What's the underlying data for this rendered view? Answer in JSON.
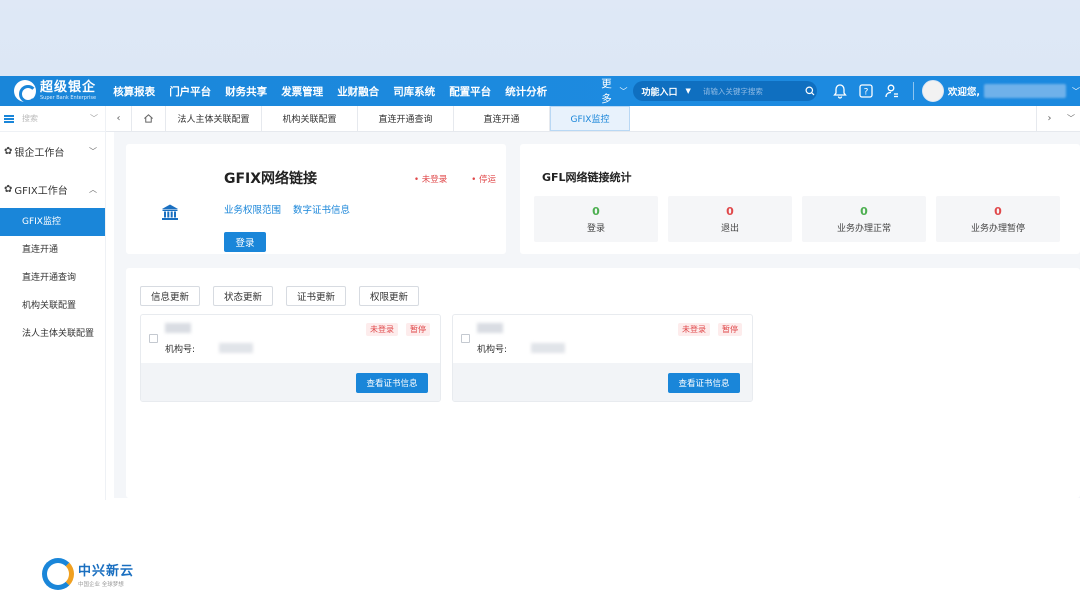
{
  "header": {
    "logo_cn": "超级银企",
    "logo_en": "Super Bank Enterprise",
    "nav": [
      "核算报表",
      "门户平台",
      "财务共享",
      "发票管理",
      "业财融合",
      "司库系统",
      "配置平台",
      "统计分析"
    ],
    "more_label": "更多",
    "combo_label": "功能入口",
    "search_placeholder": "请输入关键字搜索",
    "welcome": "欢迎您,"
  },
  "sidebar": {
    "search_placeholder": "搜索",
    "groups": [
      {
        "label": "银企工作台"
      },
      {
        "label": "GFIX工作台"
      }
    ],
    "items": [
      "GFIX监控",
      "直连开通",
      "直连开通查询",
      "机构关联配置",
      "法人主体关联配置"
    ]
  },
  "tabs": [
    "法人主体关联配置",
    "机构关联配置",
    "直连开通查询",
    "直连开通",
    "GFIX监控"
  ],
  "gfix": {
    "title": "GFIX网络链接",
    "status": [
      "未登录",
      "停运"
    ],
    "links": [
      "业务权限范围",
      "数字证书信息"
    ],
    "login_label": "登录"
  },
  "stats": {
    "title": "GFL网络链接统计",
    "items": [
      {
        "value": "0",
        "label": "登录",
        "color": "#4caf50"
      },
      {
        "value": "0",
        "label": "退出",
        "color": "#e0484a"
      },
      {
        "value": "0",
        "label": "业务办理正常",
        "color": "#4caf50"
      },
      {
        "value": "0",
        "label": "业务办理暂停",
        "color": "#e0484a"
      }
    ]
  },
  "actions": [
    "信息更新",
    "状态更新",
    "证书更新",
    "权限更新"
  ],
  "institutions": [
    {
      "id_label": "机构号:",
      "badges": [
        "未登录",
        "暂停"
      ],
      "button": "查看证书信息"
    },
    {
      "id_label": "机构号:",
      "badges": [
        "未登录",
        "暂停"
      ],
      "button": "查看证书信息"
    }
  ],
  "footer": {
    "brand": "中兴新云",
    "tagline": "中国企业 全球梦想"
  }
}
